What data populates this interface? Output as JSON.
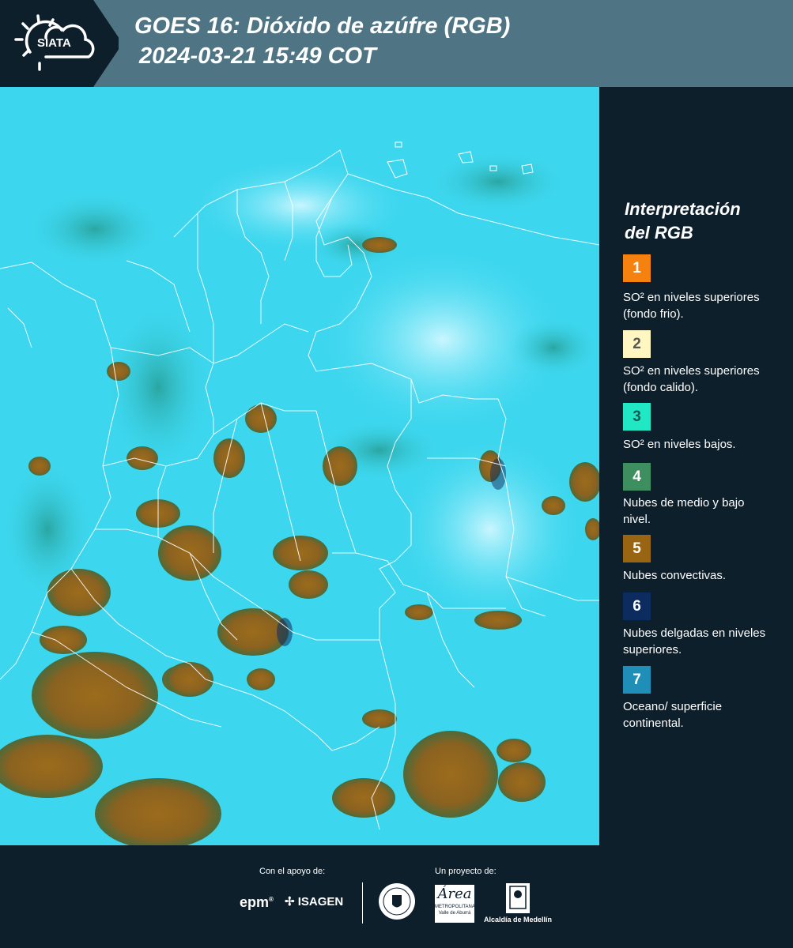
{
  "header": {
    "logo_text": "SIATA",
    "title": "GOES 16: Dióxido de azúfre (RGB)",
    "subtitle": "2024-03-21 15:49 COT"
  },
  "legend": {
    "title_line1": "Interpretación",
    "title_line2": "del RGB",
    "items": [
      {
        "num": "1",
        "color": "#f5820f",
        "num_color": "#ffffff",
        "label": "SO² en niveles superiores (fondo frio)."
      },
      {
        "num": "2",
        "color": "#fff7c2",
        "num_color": "#555555",
        "label": "SO² en niveles superiores (fondo calido)."
      },
      {
        "num": "3",
        "color": "#20e8c4",
        "num_color": "#1a5a54",
        "label": "SO² en niveles bajos."
      },
      {
        "num": "4",
        "color": "#3d8f5f",
        "num_color": "#ffffff",
        "label": "Nubes de medio y bajo nivel."
      },
      {
        "num": "5",
        "color": "#9a6512",
        "num_color": "#ffffff",
        "label": "Nubes convectivas."
      },
      {
        "num": "6",
        "color": "#0c2b5e",
        "num_color": "#ffffff",
        "label": "Nubes delgadas en niveles superiores."
      },
      {
        "num": "7",
        "color": "#1f8fb8",
        "num_color": "#ffffff",
        "label": "Oceano/ superficie continental."
      }
    ]
  },
  "footer": {
    "support_label": "Con el apoyo de:",
    "project_label": "Un proyecto de:",
    "sponsor_epm": "epm",
    "sponsor_isagen": "ISAGEN",
    "area_logo_text": "Área",
    "area_sub1": "METROPOLITANA",
    "area_sub2": "Valle de Aburrá",
    "alcaldia": "Alcaldía de Medellín"
  }
}
